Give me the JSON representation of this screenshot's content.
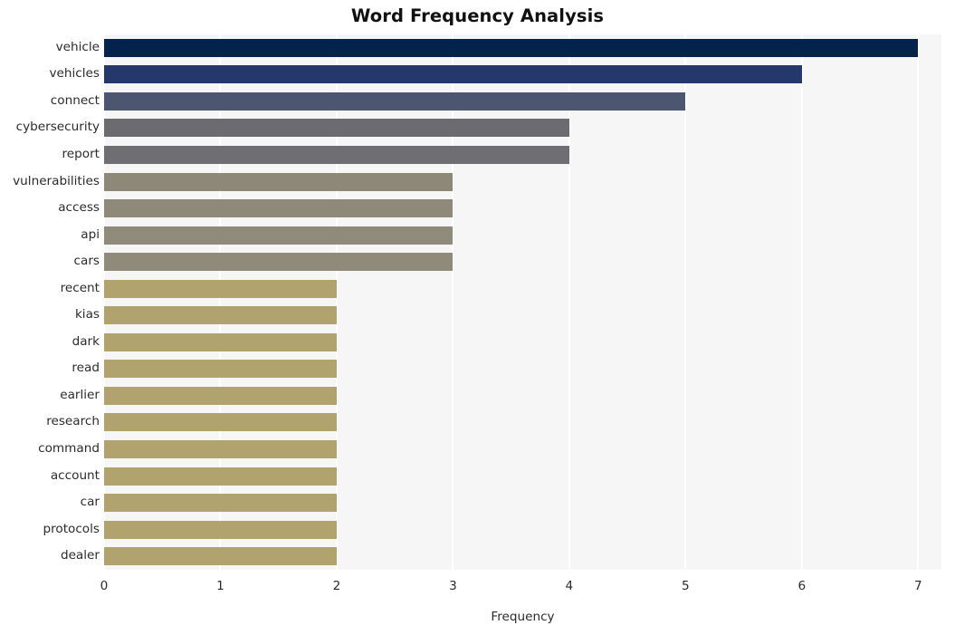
{
  "chart_data": {
    "type": "bar",
    "orientation": "horizontal",
    "title": "Word Frequency Analysis",
    "xlabel": "Frequency",
    "ylabel": "",
    "categories": [
      "vehicle",
      "vehicles",
      "connect",
      "cybersecurity",
      "report",
      "vulnerabilities",
      "access",
      "api",
      "cars",
      "recent",
      "kias",
      "dark",
      "read",
      "earlier",
      "research",
      "command",
      "account",
      "car",
      "protocols",
      "dealer"
    ],
    "values": [
      7,
      6,
      5,
      4,
      4,
      3,
      3,
      3,
      3,
      2,
      2,
      2,
      2,
      2,
      2,
      2,
      2,
      2,
      2,
      2
    ],
    "xlim": [
      0,
      7.2
    ],
    "xticks": [
      "0",
      "1",
      "2",
      "3",
      "4",
      "5",
      "6",
      "7"
    ],
    "xtick_values": [
      0,
      1,
      2,
      3,
      4,
      5,
      6,
      7
    ],
    "grid": true,
    "grid_color": "#ffffff",
    "plot_background": "#f6f6f7",
    "figure_background": "#ffffff",
    "legend": "none",
    "bar_colors": [
      "#04234c",
      "#24386b",
      "#4d5671",
      "#6b6b70",
      "#6e6e73",
      "#8d8878",
      "#8e8979",
      "#8f8a7a",
      "#8f8a7a",
      "#b0a36d",
      "#b0a36d",
      "#b0a36d",
      "#b0a36d",
      "#b0a36d",
      "#b0a36d",
      "#b0a36d",
      "#b0a36d",
      "#b0a36d",
      "#b0a36d",
      "#b0a36d"
    ]
  }
}
